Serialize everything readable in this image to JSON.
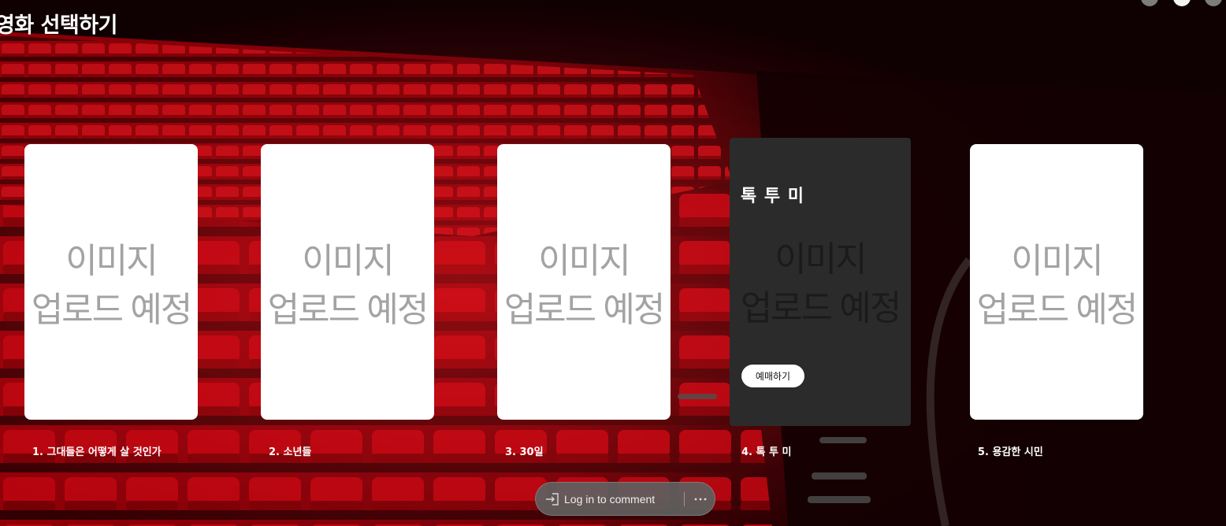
{
  "page": {
    "title": "영화 선택하기"
  },
  "movies": [
    {
      "caption": "1. 그대들은 어떻게 살 것인가",
      "placeholder_line1": "이미지",
      "placeholder_line2": "업로드 예정"
    },
    {
      "caption": "2. 소년들",
      "placeholder_line1": "이미지",
      "placeholder_line2": "업로드 예정"
    },
    {
      "caption": "3. 30일",
      "placeholder_line1": "이미지",
      "placeholder_line2": "업로드 예정"
    },
    {
      "caption": "4. 톡 투 미",
      "title": "톡 투 미",
      "placeholder_line1": "이미지",
      "placeholder_line2": "업로드 예정",
      "book_label": "예매하기"
    },
    {
      "caption": "5. 용감한 시민",
      "placeholder_line1": "이미지",
      "placeholder_line2": "업로드 예정"
    }
  ],
  "comment_bar": {
    "login_label": "Log in to comment",
    "login_icon": "login-arrow-icon",
    "more_icon": "more-dots-icon",
    "more_label": "···"
  },
  "colors": {
    "card_bg": "#ffffff",
    "card_hover_bg": "#2b2b2b",
    "placeholder_text": "#a3a3a3",
    "seat_red": "#c8000c"
  }
}
